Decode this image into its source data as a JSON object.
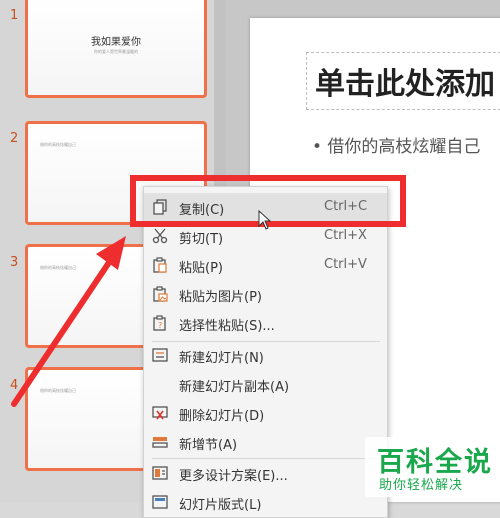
{
  "thumbnails": [
    {
      "number": "1",
      "title": "我如果爱你",
      "subtitle": "你的爱人是世界最温暖的"
    },
    {
      "number": "2",
      "bullet": "借你的高枝炫耀自己"
    },
    {
      "number": "3",
      "bullet": "借你的高枝炫耀自己"
    },
    {
      "number": "4",
      "bullet": "借你的高枝炫耀自己"
    }
  ],
  "slide": {
    "title_placeholder": "单击此处添加",
    "body_text": "• 借你的高枝炫耀自己"
  },
  "context_menu": {
    "items": [
      {
        "label": "复制(C)",
        "shortcut": "Ctrl+C",
        "icon": "copy-icon"
      },
      {
        "label": "剪切(T)",
        "shortcut": "Ctrl+X",
        "icon": "cut-icon"
      },
      {
        "label": "粘贴(P)",
        "shortcut": "Ctrl+V",
        "icon": "paste-icon"
      },
      {
        "label": "粘贴为图片(P)",
        "shortcut": "",
        "icon": "paste-as-image-icon"
      },
      {
        "label": "选择性粘贴(S)...",
        "shortcut": "",
        "icon": "paste-special-icon"
      },
      {
        "label": "新建幻灯片(N)",
        "shortcut": "",
        "icon": "new-slide-icon"
      },
      {
        "label": "新建幻灯片副本(A)",
        "shortcut": "",
        "icon": ""
      },
      {
        "label": "删除幻灯片(D)",
        "shortcut": "",
        "icon": "delete-slide-icon"
      },
      {
        "label": "新增节(A)",
        "shortcut": "",
        "icon": "new-section-icon"
      },
      {
        "label": "更多设计方案(E)...",
        "shortcut": "",
        "icon": "design-icon"
      },
      {
        "label": "幻灯片版式(L)",
        "shortcut": "",
        "icon": "layout-icon"
      }
    ]
  },
  "watermark": {
    "logo": "百科全说",
    "slogan": "助你轻松解决"
  },
  "colors": {
    "accent": "#f0704a",
    "highlight": "#ee2e2e",
    "watermark": "#1aa84d"
  }
}
